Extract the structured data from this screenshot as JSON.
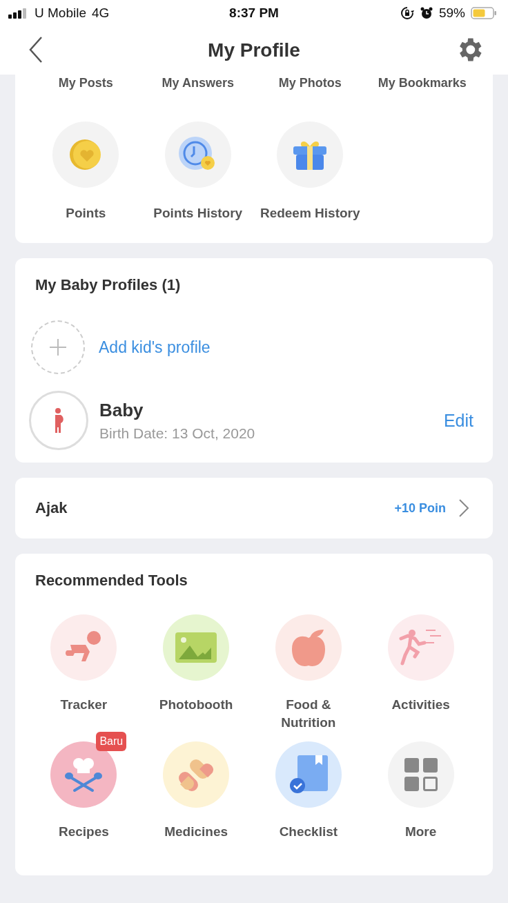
{
  "status_bar": {
    "carrier": "U Mobile",
    "network": "4G",
    "time": "8:37 PM",
    "battery": "59%"
  },
  "nav": {
    "title": "My Profile"
  },
  "activity_links": [
    {
      "label": "My Posts"
    },
    {
      "label": "My Answers"
    },
    {
      "label": "My Photos"
    },
    {
      "label": "My Bookmarks"
    }
  ],
  "points_links": [
    {
      "label": "Points",
      "kind": "coin"
    },
    {
      "label": "Points History",
      "kind": "history"
    },
    {
      "label": "Redeem History",
      "kind": "gift"
    }
  ],
  "baby_profiles": {
    "title": "My Baby Profiles (1)",
    "add_label": "Add kid's profile",
    "profiles": [
      {
        "name": "Baby",
        "birth": "Birth Date: 13 Oct, 2020",
        "action": "Edit"
      }
    ]
  },
  "invite": {
    "label": "Ajak",
    "reward": "+10 Poin"
  },
  "tools": {
    "title": "Recommended Tools",
    "items": [
      {
        "label": "Tracker",
        "kind": "tracker"
      },
      {
        "label": "Photobooth",
        "kind": "photo"
      },
      {
        "label": "Food &\nNutrition",
        "kind": "food"
      },
      {
        "label": "Activities",
        "kind": "activity"
      },
      {
        "label": "Recipes",
        "kind": "recipe",
        "badge": "Baru"
      },
      {
        "label": "Medicines",
        "kind": "medicine"
      },
      {
        "label": "Checklist",
        "kind": "checklist"
      },
      {
        "label": "More",
        "kind": "more"
      }
    ]
  }
}
